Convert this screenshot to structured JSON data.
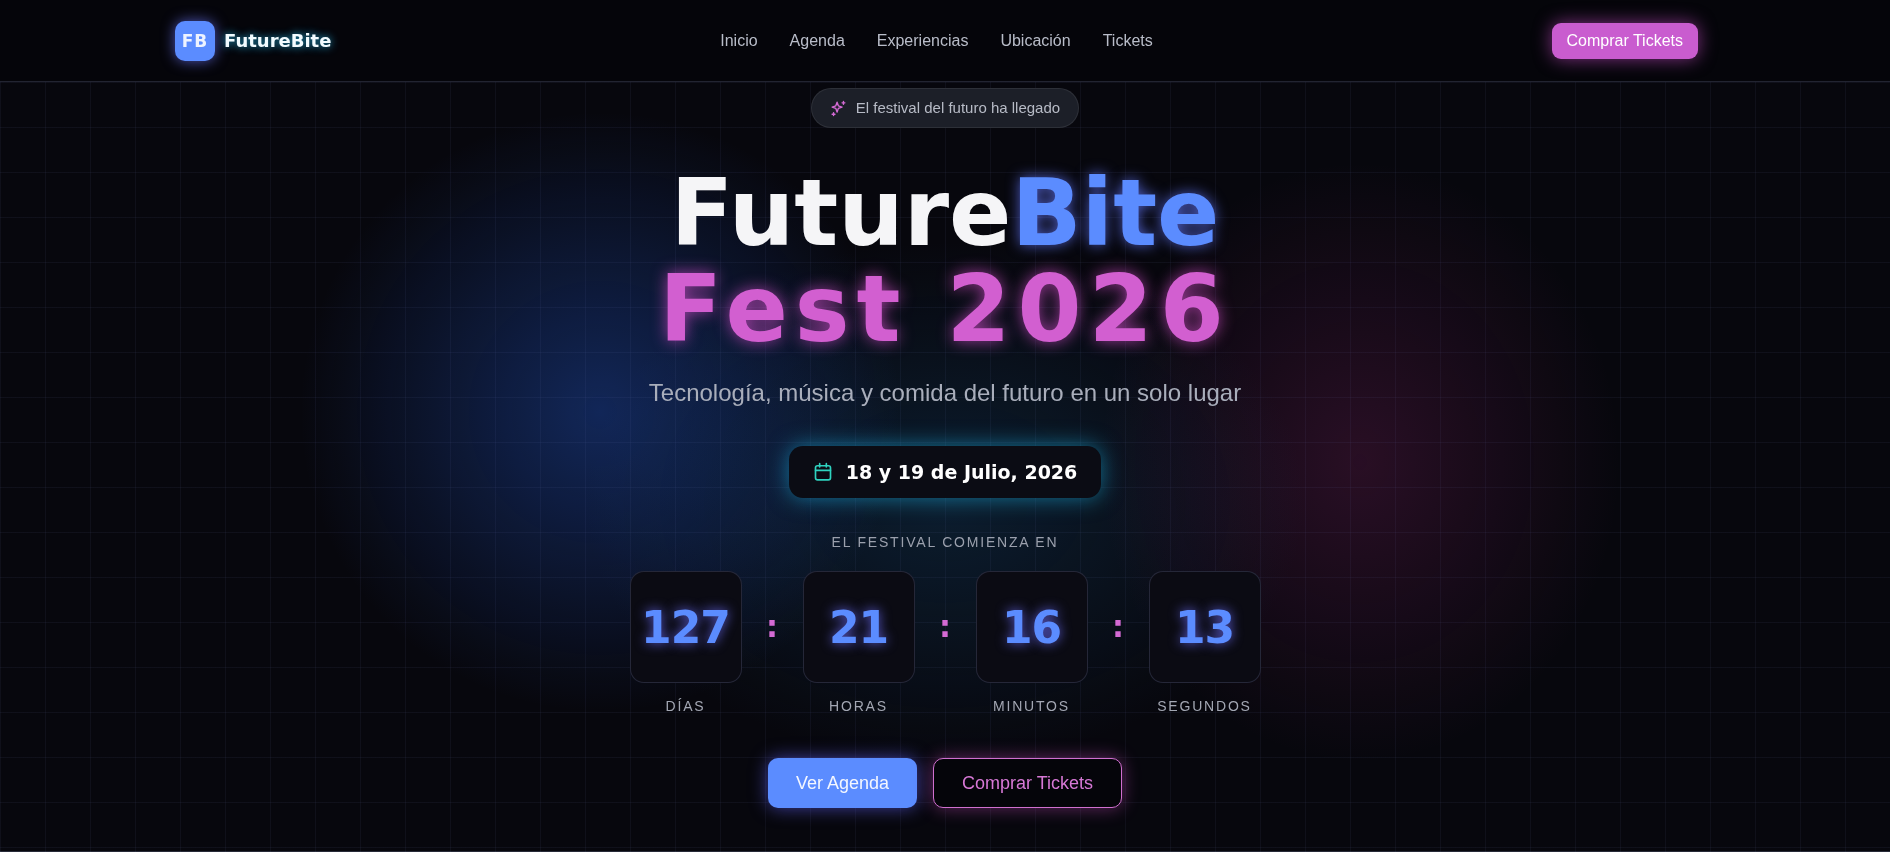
{
  "nav": {
    "logo": {
      "mark": "FB",
      "name": "FutureBite"
    },
    "links": [
      {
        "label": "Inicio"
      },
      {
        "label": "Agenda"
      },
      {
        "label": "Experiencias"
      },
      {
        "label": "Ubicación"
      },
      {
        "label": "Tickets"
      }
    ],
    "cta": "Comprar Tickets"
  },
  "hero": {
    "badge": "El festival del futuro ha llegado",
    "title": {
      "line_1": [
        {
          "text": "Future",
          "kind": "plain"
        },
        {
          "text": "Bite",
          "kind": "accent"
        }
      ],
      "line_2": "Fest 2026"
    },
    "subtitle": "Tecnología, música y comida del futuro en un solo lugar",
    "date": "18 y 19 de Julio, 2026",
    "countdown": {
      "heading": "EL FESTIVAL COMIENZA EN",
      "units": [
        {
          "value": "127",
          "label": "DÍAS"
        },
        {
          "value": "21",
          "label": "HORAS"
        },
        {
          "value": "16",
          "label": "MINUTOS"
        },
        {
          "value": "13",
          "label": "SEGUNDOS"
        }
      ],
      "separators": [
        ":",
        ":",
        ":"
      ]
    },
    "buttons": [
      {
        "label": "Ver Agenda",
        "kind": "primary"
      },
      {
        "label": "Comprar Tickets",
        "kind": "outline"
      }
    ]
  }
}
